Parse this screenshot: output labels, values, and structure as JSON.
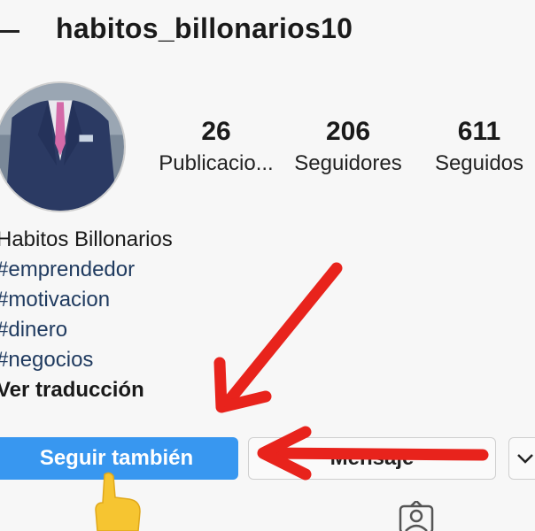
{
  "header": {
    "username": "habitos_billonarios10"
  },
  "stats": {
    "posts": {
      "value": "26",
      "label": "Publicacio..."
    },
    "followers": {
      "value": "206",
      "label": "Seguidores"
    },
    "following": {
      "value": "611",
      "label": "Seguidos"
    }
  },
  "bio": {
    "name": "Habitos Billonarios",
    "hashtags": [
      "#emprendedor",
      "#motivacion",
      "#dinero",
      "#negocios"
    ],
    "translate_link": "Ver traducción"
  },
  "actions": {
    "follow_label": "Seguir también",
    "message_label": "Mensaje"
  },
  "colors": {
    "follow_button": "#3897f0",
    "hashtag": "#1f3a5f",
    "annotation_arrow": "#e8231c"
  },
  "icons": {
    "back": "back-arrow-icon",
    "more": "chevron-down-icon",
    "tagged": "tagged-person-icon",
    "pointer": "pointing-hand-icon"
  }
}
